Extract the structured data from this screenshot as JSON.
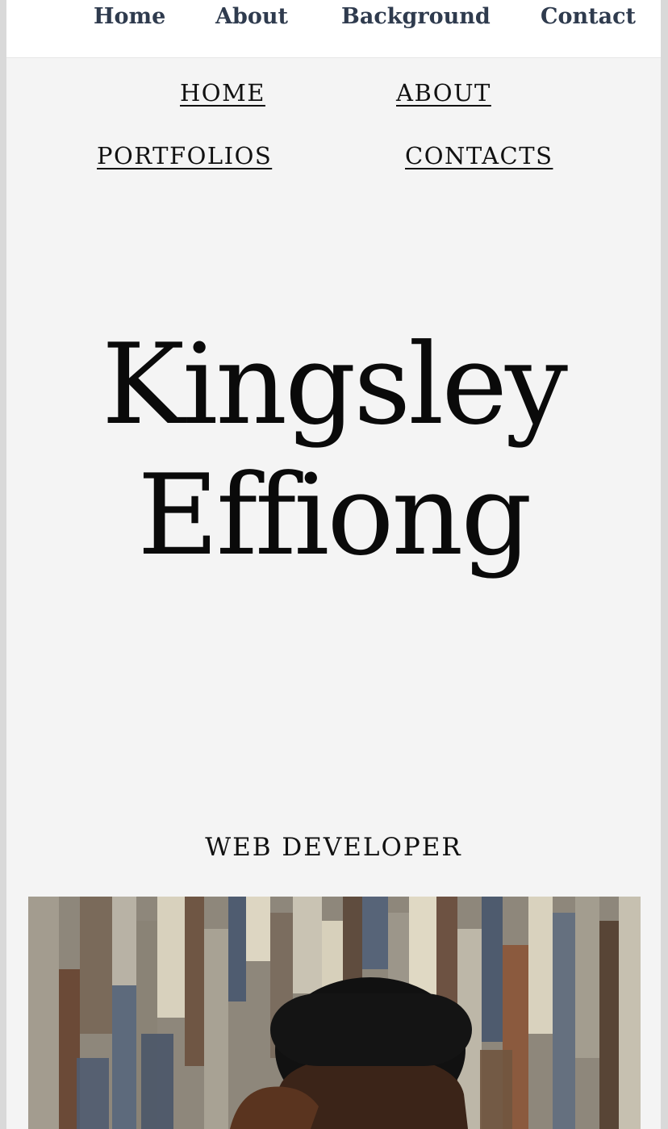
{
  "top_nav": {
    "home": "Home",
    "about": "About",
    "background": "Background",
    "contact": "Contact"
  },
  "secondary_nav": {
    "home": "HOME",
    "about": "ABOUT",
    "portfolios": "PORTFOLIOS",
    "contacts": "CONTACTS"
  },
  "hero": {
    "first_name": "Kingsley",
    "last_name": "Effiong",
    "role": "WEB DEVELOPER"
  },
  "colors": {
    "top_nav_text": "#2f3b4e",
    "page_background": "#f4f4f4",
    "text": "#111111"
  }
}
